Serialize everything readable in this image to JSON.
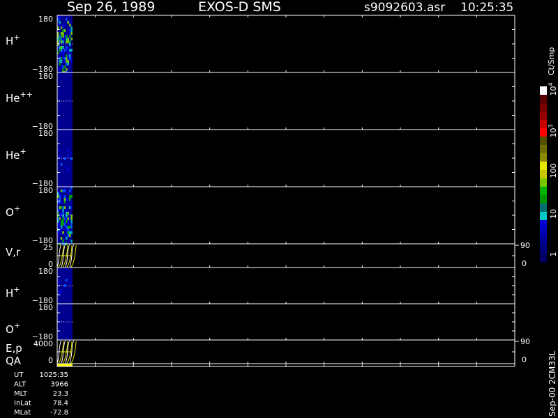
{
  "header": {
    "date": "Sep 26, 1989",
    "mission": "EXOS-D SMS",
    "file": "s9092603.asr",
    "time": "10:25:35"
  },
  "colorbar": {
    "label": "Ct/Smp",
    "tick_labels": [
      "1",
      "10",
      "100",
      "10",
      "10"
    ],
    "tick_exponents": [
      "",
      "",
      "",
      "3",
      "4"
    ],
    "colors": [
      "#000064",
      "#00007a",
      "#000094",
      "#0000b4",
      "#0000d2",
      "#00c8c8",
      "#006e6e",
      "#009600",
      "#00b400",
      "#78c800",
      "#c8c800",
      "#e6e600",
      "#8c8c00",
      "#6e6e00",
      "#505000",
      "#ff0000",
      "#c80000",
      "#960000",
      "#780000",
      "#5a0000",
      "#ffffff"
    ]
  },
  "footer": {
    "code": "Sep-00 2CM33L"
  },
  "orbit": {
    "labels": [
      "UT",
      "ALT",
      "MLT",
      "InLat",
      "MLat"
    ],
    "values": [
      "1025:35",
      "3966",
      "23.3",
      "78.4",
      "-72.8"
    ]
  },
  "chart_data": {
    "type": "heatmap",
    "x_range_minutes": [
      0,
      60
    ],
    "data_coverage_minutes": [
      0,
      2
    ],
    "panels": [
      {
        "label": "H",
        "sup": "+",
        "ytop": "180",
        "ybot": "−180",
        "kind": "spectrogram",
        "peak_counts": 100
      },
      {
        "label": "He",
        "sup": "++",
        "ytop": "180",
        "ybot": "−180",
        "kind": "spectrogram",
        "peak_counts": 1
      },
      {
        "label": "He",
        "sup": "+",
        "ytop": "180",
        "ybot": "−180",
        "kind": "spectrogram",
        "peak_counts": 10
      },
      {
        "label": "O",
        "sup": "+",
        "ytop": "180",
        "ybot": "−180",
        "kind": "spectrogram",
        "peak_counts": 100
      },
      {
        "label": "V,r",
        "sup": "",
        "ytop": "25",
        "ybot": "0",
        "rtop": "90",
        "rbot": "0",
        "kind": "lines"
      },
      {
        "label": "H",
        "sup": "+",
        "ytop": "180",
        "ybot": "−180",
        "kind": "spectrogram",
        "peak_counts": 10
      },
      {
        "label": "O",
        "sup": "+",
        "ytop": "180",
        "ybot": "−180",
        "kind": "spectrogram",
        "peak_counts": 1
      },
      {
        "label": "E,p",
        "sup": "",
        "ytop": "4000",
        "ybot": "0",
        "rtop": "90",
        "rbot": "0",
        "kind": "lines"
      },
      {
        "label": "QA",
        "sup": "",
        "ytop": "",
        "ybot": "",
        "kind": "qa"
      }
    ]
  }
}
